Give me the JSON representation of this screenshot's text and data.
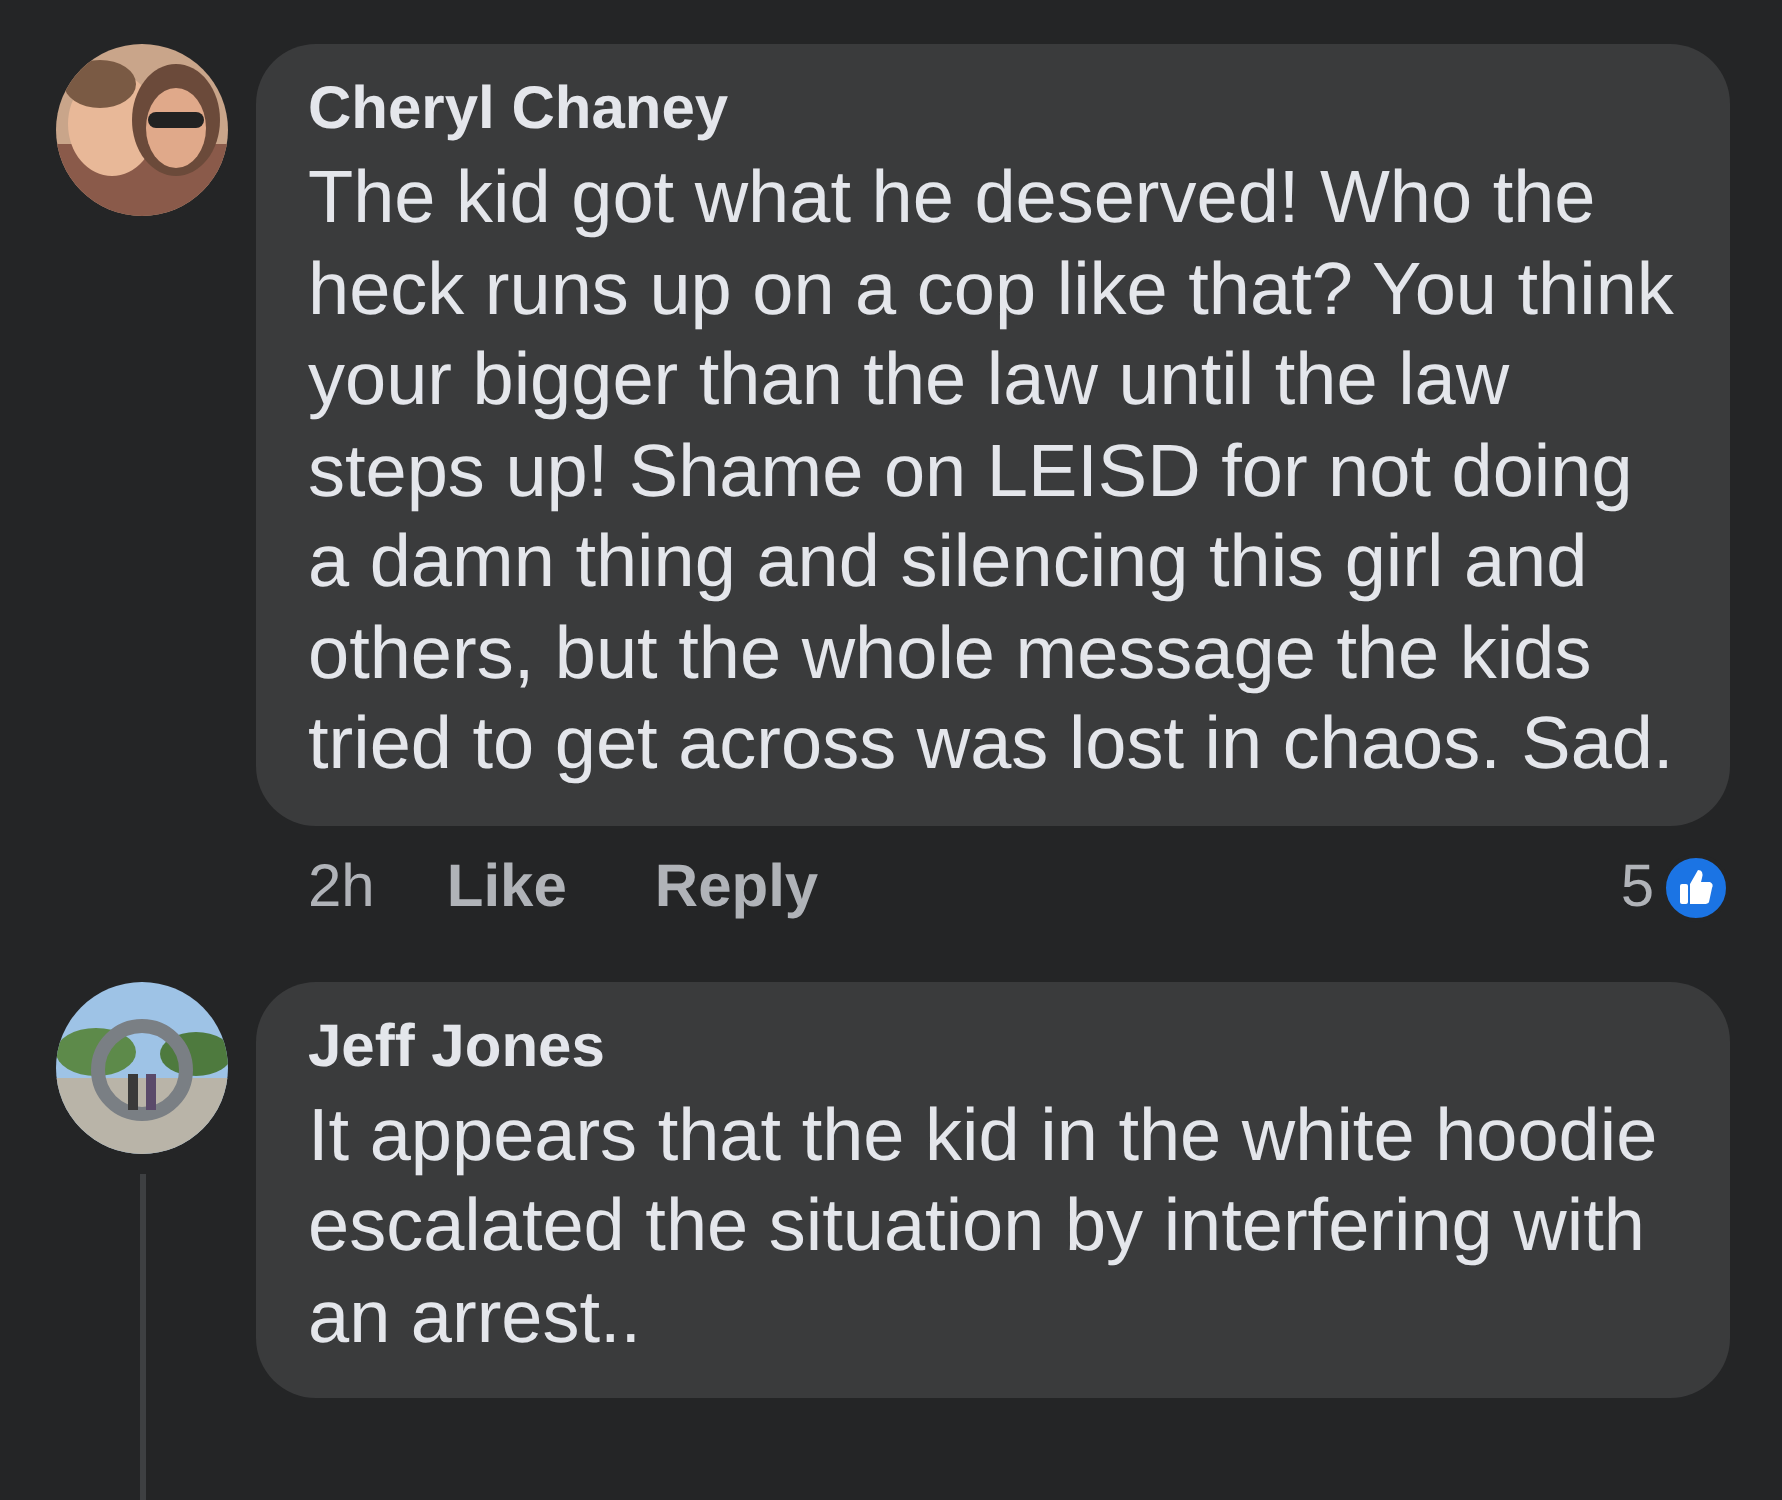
{
  "comments": [
    {
      "author": "Cheryl Chaney",
      "text": "The kid got what he deserved! Who the heck runs up on a cop like that? You think your bigger than the law until the law steps up! Shame on LEISD for not doing a damn thing and silencing this girl and others, but the whole message the kids tried to get across was lost in chaos. Sad.",
      "time": "2h",
      "actions": [
        "Like",
        "Reply"
      ],
      "reactions": "5"
    },
    {
      "author": "Jeff Jones",
      "text": "It appears that the kid in the white hoodie escalated the situation by interfering with an arrest..",
      "thread_line": true
    }
  ]
}
